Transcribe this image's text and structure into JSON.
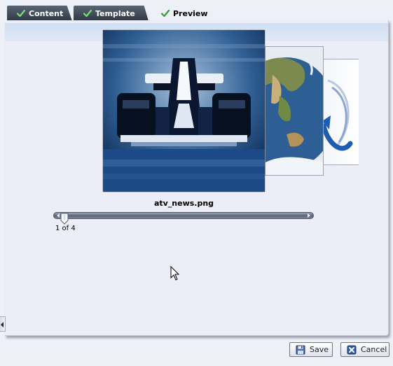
{
  "tabs": [
    {
      "label": "Content",
      "state": "completed"
    },
    {
      "label": "Template",
      "state": "completed"
    },
    {
      "label": "Preview",
      "state": "active"
    }
  ],
  "preview": {
    "current_image_name": "atv_news.png",
    "position_text": "1 of 4",
    "position_index": 1,
    "total_images": 4
  },
  "buttons": {
    "save_label": "Save",
    "cancel_label": "Cancel"
  },
  "colors": {
    "tab_dark": "#3b4553",
    "check_green": "#2ea02e",
    "panel_band": "#d4e3f5",
    "slider": "#5b6577"
  }
}
